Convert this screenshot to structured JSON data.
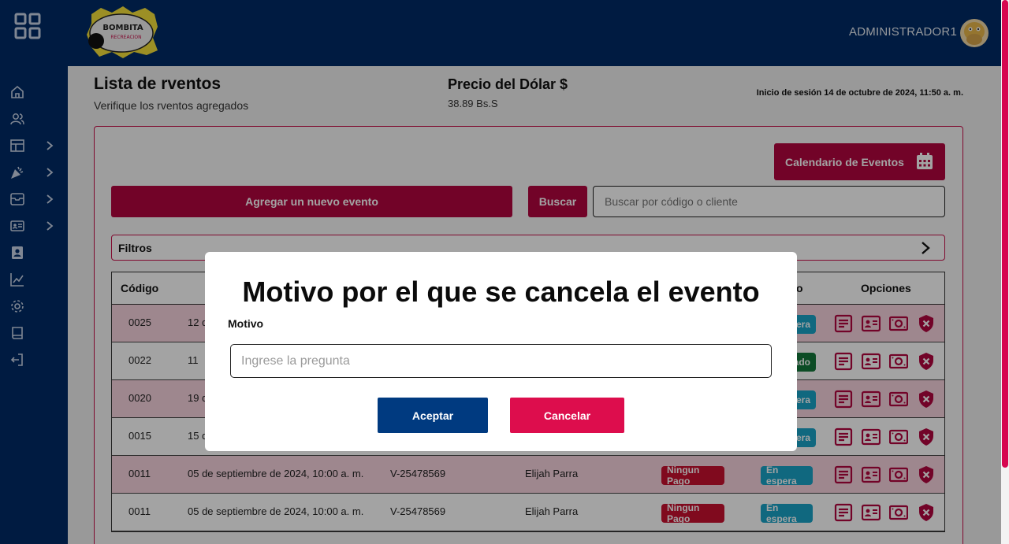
{
  "topbar": {
    "admin_name": "ADMINISTRADOR1",
    "logo_text": "BOMBITA RECREACION"
  },
  "sidebar": {
    "items": [
      {
        "icon": "home-icon"
      },
      {
        "icon": "users-icon"
      },
      {
        "icon": "layout-icon"
      },
      {
        "icon": "party-icon"
      },
      {
        "icon": "inventory-icon"
      },
      {
        "icon": "id-card-icon"
      },
      {
        "icon": "contacts-icon"
      },
      {
        "icon": "chart-icon"
      },
      {
        "icon": "settings-icon"
      },
      {
        "icon": "book-icon"
      },
      {
        "icon": "logout-icon"
      }
    ]
  },
  "header": {
    "title": "Lista de rventos",
    "subtitle": "Verifique los rventos agregados",
    "dolar_title": "Precio del Dólar $",
    "dolar_value": "38.89 Bs.S",
    "session": "Inicio de sesión 14 de octubre de 2024, 11:50 a. m."
  },
  "toolbar": {
    "calendar_label": "Calendario de Eventos",
    "add_label": "Agregar un nuevo evento",
    "search_button": "Buscar",
    "search_placeholder": "Buscar por código o cliente",
    "filters_label": "Filtros"
  },
  "table": {
    "headers": {
      "codigo": "Código",
      "estado_suffix": "o",
      "opciones": "Opciones"
    },
    "rows": [
      {
        "code": "0025",
        "date": "12 d",
        "badge2": "pera",
        "badge2_color": "cyan"
      },
      {
        "code": "0022",
        "date": "11",
        "badge2": "ado",
        "badge2_color": "green"
      },
      {
        "code": "0020",
        "date": "19 d",
        "badge2": "pera",
        "badge2_color": "cyan"
      },
      {
        "code": "0015",
        "date": "15 d",
        "badge2": "pera",
        "badge2_color": "cyan"
      },
      {
        "code": "0011",
        "date": "05 de septiembre de 2024, 10:00 a. m.",
        "id": "V-25478569",
        "client": "Elijah Parra",
        "badge1": "Ningun Pago",
        "badge2": "En espera",
        "badge2_color": "cyan"
      },
      {
        "code": "0011",
        "date": "05 de septiembre de 2024, 10:00 a. m.",
        "id": "V-25478569",
        "client": "Elijah Parra",
        "badge1": "Ningun Pago",
        "badge2": "En espera",
        "badge2_color": "cyan"
      }
    ]
  },
  "modal": {
    "title": "Motivo por el que se cancela el evento",
    "field_label": "Motivo",
    "placeholder": "Ingrese la pregunta",
    "accept": "Aceptar",
    "cancel": "Cancelar"
  },
  "colors": {
    "navy": "#002b66",
    "brand": "#b3063f",
    "accept": "#003a80",
    "cancel": "#dd0d4d"
  }
}
